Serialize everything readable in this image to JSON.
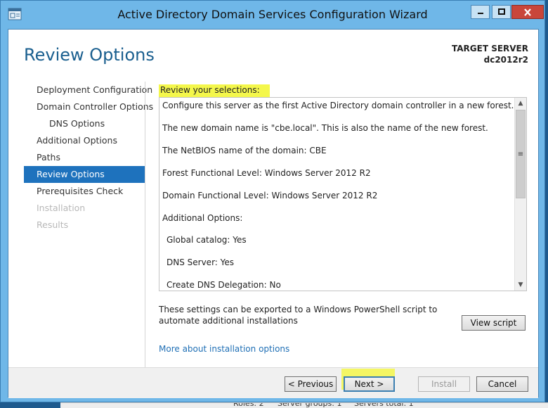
{
  "window": {
    "title": "Active Directory Domain Services Configuration Wizard"
  },
  "page": {
    "heading": "Review Options",
    "target_server_label": "TARGET SERVER",
    "target_server_name": "dc2012r2"
  },
  "nav": {
    "items": [
      {
        "label": "Deployment Configuration"
      },
      {
        "label": "Domain Controller Options"
      },
      {
        "label": "DNS Options"
      },
      {
        "label": "Additional Options"
      },
      {
        "label": "Paths"
      },
      {
        "label": "Review Options"
      },
      {
        "label": "Prerequisites Check"
      },
      {
        "label": "Installation"
      },
      {
        "label": "Results"
      }
    ]
  },
  "review": {
    "label": "Review your selections:",
    "lines": [
      "Configure this server as the first Active Directory domain controller in a new forest.",
      "The new domain name is \"cbe.local\". This is also the name of the new forest.",
      "The NetBIOS name of the domain: CBE",
      "Forest Functional Level: Windows Server 2012 R2",
      "Domain Functional Level: Windows Server 2012 R2",
      "Additional Options:",
      "Global catalog: Yes",
      "DNS Server: Yes",
      "Create DNS Delegation: No"
    ]
  },
  "export": {
    "text": "These settings can be exported to a Windows PowerShell script to automate additional installations",
    "view_script": "View script"
  },
  "more_link": "More about installation options",
  "buttons": {
    "previous": "< Previous",
    "next": "Next >",
    "install": "Install",
    "cancel": "Cancel"
  },
  "taskbar": {
    "roles": "Roles: 2",
    "server_groups": "Server groups: 1",
    "servers_total": "Servers total: 1"
  },
  "colors": {
    "titlebar": "#6fb7e8",
    "accent": "#1e72bd",
    "highlight": "#f4f74b",
    "link": "#1f6fb5"
  }
}
